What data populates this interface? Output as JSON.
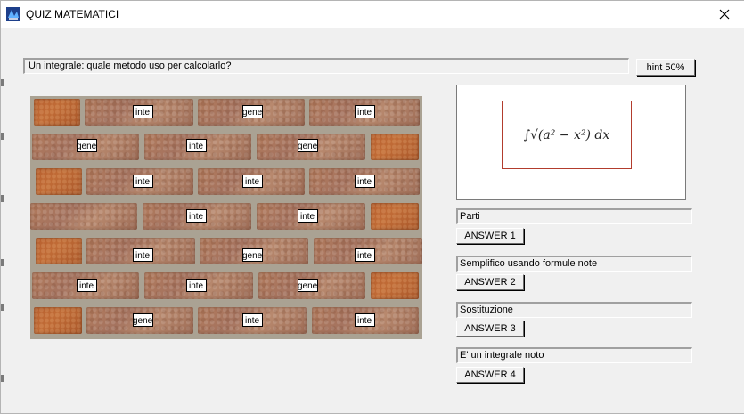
{
  "window": {
    "title": "QUIZ MATEMATICI",
    "close_glyph": "✕"
  },
  "question": {
    "text": "Un integrale: quale metodo uso per calcolarlo?",
    "hint_label": "hint 50%"
  },
  "wall": {
    "tile_short_a": "inte",
    "tile_short_b": "gene"
  },
  "formula": {
    "text": "∫√(a² − x²) dx",
    "accent_color": "#b23c2d"
  },
  "answers": [
    {
      "label": "Parti",
      "button": "ANSWER 1"
    },
    {
      "label": "Semplifico usando formule note",
      "button": "ANSWER 2"
    },
    {
      "label": "Sostituzione",
      "button": "ANSWER 3"
    },
    {
      "label": "E' un integrale noto",
      "button": "ANSWER 4"
    }
  ],
  "tiles": [
    "inte",
    "gene",
    "inte",
    "gene",
    "inte",
    "gene",
    "inte",
    "inte",
    "inte",
    "inte",
    "inte",
    "inte",
    "gene",
    "inte",
    "inte",
    "inte",
    "gene",
    "gene",
    "inte",
    "inte"
  ]
}
